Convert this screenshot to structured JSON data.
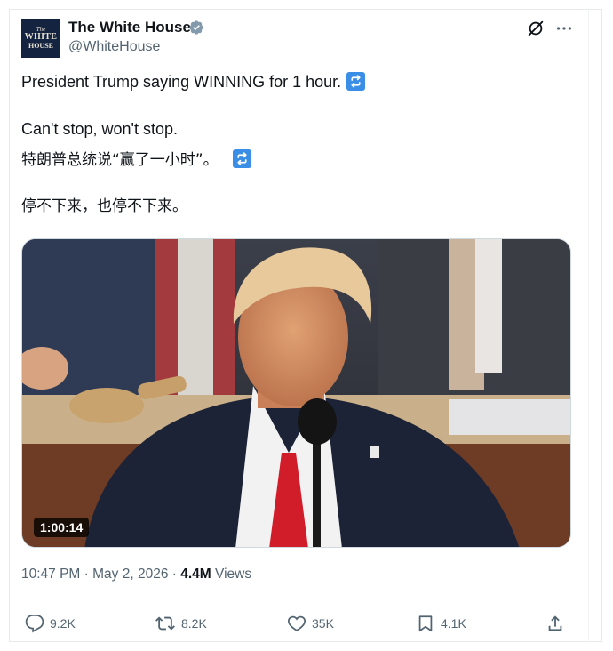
{
  "account": {
    "name": "The White House",
    "handle": "@WhiteHouse",
    "avatar_text": [
      "The",
      "WHITE",
      "HOUSE"
    ]
  },
  "post": {
    "line1": "President Trump saying WINNING for 1 hour.",
    "line2": "Can't stop, won't stop.",
    "line3": "特朗普总统说“赢了一小时”。",
    "line4": "停不下来，也停不下来。"
  },
  "media": {
    "duration": "1:00:14"
  },
  "meta": {
    "time": "10:47 PM",
    "sep1": " · ",
    "date": "May 2, 2026",
    "sep2": " · ",
    "views_count": "4.4M",
    "views_label": " Views"
  },
  "actions": {
    "replies": "9.2K",
    "reposts": "8.2K",
    "likes": "35K",
    "bookmarks": "4.1K"
  },
  "icons": [
    "verified-badge-icon",
    "grok-icon",
    "more-icon",
    "repeat-emoji-icon",
    "reply-icon",
    "repost-icon",
    "like-icon",
    "bookmark-icon",
    "share-icon"
  ],
  "colors": {
    "verified": "#829aab",
    "emoji": "#3a8ee6",
    "muted": "#536471"
  }
}
